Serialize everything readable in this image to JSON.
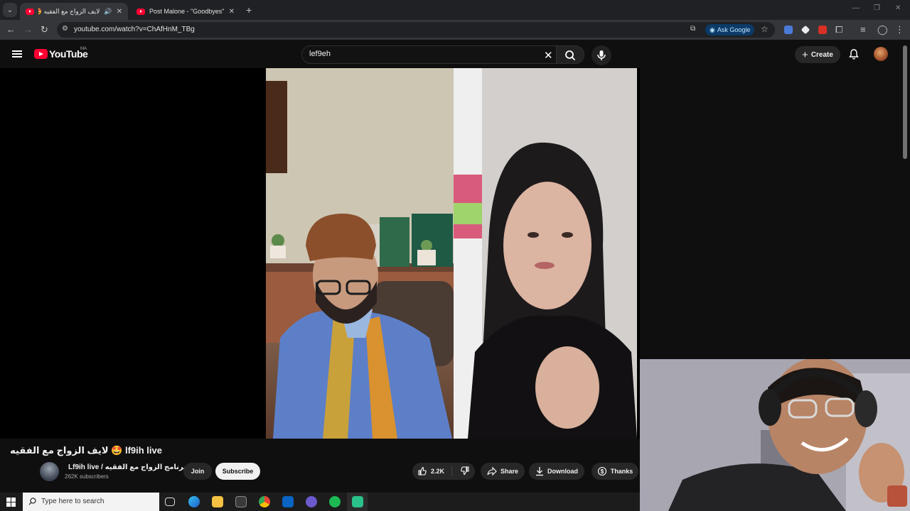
{
  "browser": {
    "tabs": [
      {
        "title": "لايف الزواج مع الفقيه 🤩 - YouTube",
        "active": true
      },
      {
        "title": "Post Malone - \"Goodbyes\" ft. Y",
        "active": false
      }
    ],
    "url": "youtube.com/watch?v=ChAfHnM_TBg",
    "ask_google_label": "Ask Google"
  },
  "youtube": {
    "logo_text": "YouTube",
    "country_code": "MA",
    "search_value": "lef9eh",
    "create_label": "Create"
  },
  "video": {
    "title": "lf9ih live 🤩 لايف الزواج مع الفقيه",
    "channel_name": "Lf9ih live / برنامج الزواج مع الفقيه",
    "subscribers": "262K subscribers",
    "join_label": "Join",
    "subscribe_label": "Subscribe",
    "likes": "2.2K",
    "share_label": "Share",
    "download_label": "Download",
    "thanks_label": "Thanks"
  },
  "taskbar": {
    "search_placeholder": "Type here to search"
  },
  "colors": {
    "brand_red": "#ff0033",
    "background": "#0f0f0f",
    "ask_google_bg": "#0b3a68"
  }
}
